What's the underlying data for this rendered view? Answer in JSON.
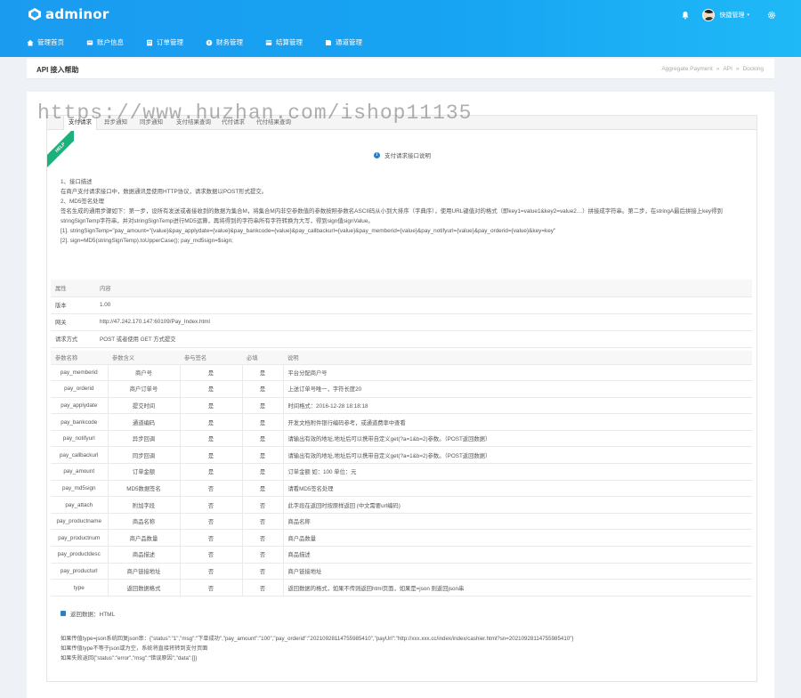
{
  "app": {
    "logo_text": "adminor",
    "user_name": "快捷管理",
    "caret": "▾"
  },
  "nav": [
    {
      "label": "管理首页",
      "icon": "home-icon"
    },
    {
      "label": "账户信息",
      "icon": "account-icon"
    },
    {
      "label": "订单管理",
      "icon": "order-icon"
    },
    {
      "label": "财务管理",
      "icon": "finance-icon"
    },
    {
      "label": "结算管理",
      "icon": "settlement-icon"
    },
    {
      "label": "通道管理",
      "icon": "channel-icon"
    }
  ],
  "page": {
    "title": "API 接入帮助",
    "breadcrumb": [
      "Aggregate Payment",
      "API",
      "Docking"
    ],
    "breadcrumb_sep": "»"
  },
  "watermark": "https://www.huzhan.com/ishop11135",
  "tabs": [
    "支付请求",
    "异步通知",
    "同步通知",
    "支付结果查询",
    "代付请求",
    "代付结果查询"
  ],
  "ribbon": "HELP",
  "request_title": "支付请求接口说明",
  "notes": [
    "1、接口描述",
    "在商户支付请求接口中，数据通讯是使用HTTP协议，请求数据以POST形式提交。",
    "2、MD5签名处理",
    "签名生成的通用步骤如下：第一步，设所有发送或者接收到的数据为集合M，将集合M内非空参数值的参数按照参数名ASCII码从小到大排序（字典序），使用URL键值对的格式（即key1=value1&key2=value2…）拼接成字符串。第二步，在stringA最后拼接上key得到stringSignTemp字符串，并对stringSignTemp进行MD5运算，再将得到的字符串所有字符转换为大写，得到sign值signValue。",
    "[1]. stringSignTemp=\"pay_amount=\"{value}&pay_applydate={value}&pay_bankcode={value}&pay_callbackurl={value}&pay_memberid={value}&pay_notifyurl={value}&pay_orderid={value}&key=key\"",
    "[2]. sign=MD5(stringSignTemp).toUpperCase(); pay_md5sign=$sign;"
  ],
  "info_table": {
    "headers": [
      "属性",
      "内容"
    ],
    "rows": [
      [
        "版本",
        "1.00"
      ],
      [
        "网关",
        "http://47.242.170.147:60109/Pay_Index.html"
      ],
      [
        "请求方式",
        "POST 或者使用 GET 方式提交"
      ]
    ]
  },
  "param_table": {
    "headers": [
      "参数名称",
      "参数含义",
      "参与签名",
      "必填",
      "说明"
    ],
    "rows": [
      [
        "pay_memberid",
        "商户号",
        "是",
        "是",
        "平台分配商户号"
      ],
      [
        "pay_orderid",
        "商户订单号",
        "是",
        "是",
        "上送订单号唯一，字符长度20"
      ],
      [
        "pay_applydate",
        "提交时间",
        "是",
        "是",
        "时间格式：2016-12-28 18:18:18"
      ],
      [
        "pay_bankcode",
        "通道编码",
        "是",
        "是",
        "开发文档附件银行编码参考，或通道费率中查看"
      ],
      [
        "pay_notifyurl",
        "异步回调",
        "是",
        "是",
        "请输出有效的地址,地址后可以携带自定义get(?a=1&b=2)参数。（POST返回数据）"
      ],
      [
        "pay_callbackurl",
        "同步回调",
        "是",
        "是",
        "请输出有效的地址,地址后可以携带自定义get(?a=1&b=2)参数。（POST返回数据）"
      ],
      [
        "pay_amount",
        "订单金额",
        "是",
        "是",
        "订单金额 如：100 单位：元"
      ],
      [
        "pay_md5sign",
        "MD5数据签名",
        "否",
        "是",
        "请看MD5签名处理"
      ],
      [
        "pay_attach",
        "附加字段",
        "否",
        "否",
        "此字段在返回时按原样返回 (中文需要url编码)"
      ],
      [
        "pay_productname",
        "商品名称",
        "否",
        "否",
        "商品名称"
      ],
      [
        "pay_productnum",
        "商户品数量",
        "否",
        "否",
        "商户品数量"
      ],
      [
        "pay_productdesc",
        "商品描述",
        "否",
        "否",
        "商品描述"
      ],
      [
        "pay_producturl",
        "商户链接地址",
        "否",
        "否",
        "商户链接地址"
      ],
      [
        "type",
        "返回数据格式",
        "否",
        "否",
        "返回数据的格式，如果不传则返回html页面，如果是=json 则返回json串"
      ]
    ]
  },
  "return_title": "返回数据：HTML",
  "return_lines": [
    "如果传值type=json系统回复json串：{\"status\":\"1\",\"msg\":\"下单成功\",\"pay_amount\":\"100\",\"pay_orderid\":\"20210928114755985410\",\"payUrl\":\"http://xxx.xxx.cc/index/index/cashier.html?sn=20210928114755985410\"}",
    "如果传值type不等于json或为空，系统将直接将转到支付页面",
    "如果失败返回{\"status\":\"error\",\"msg\":\"错误原因\",\"data\":[]}"
  ]
}
